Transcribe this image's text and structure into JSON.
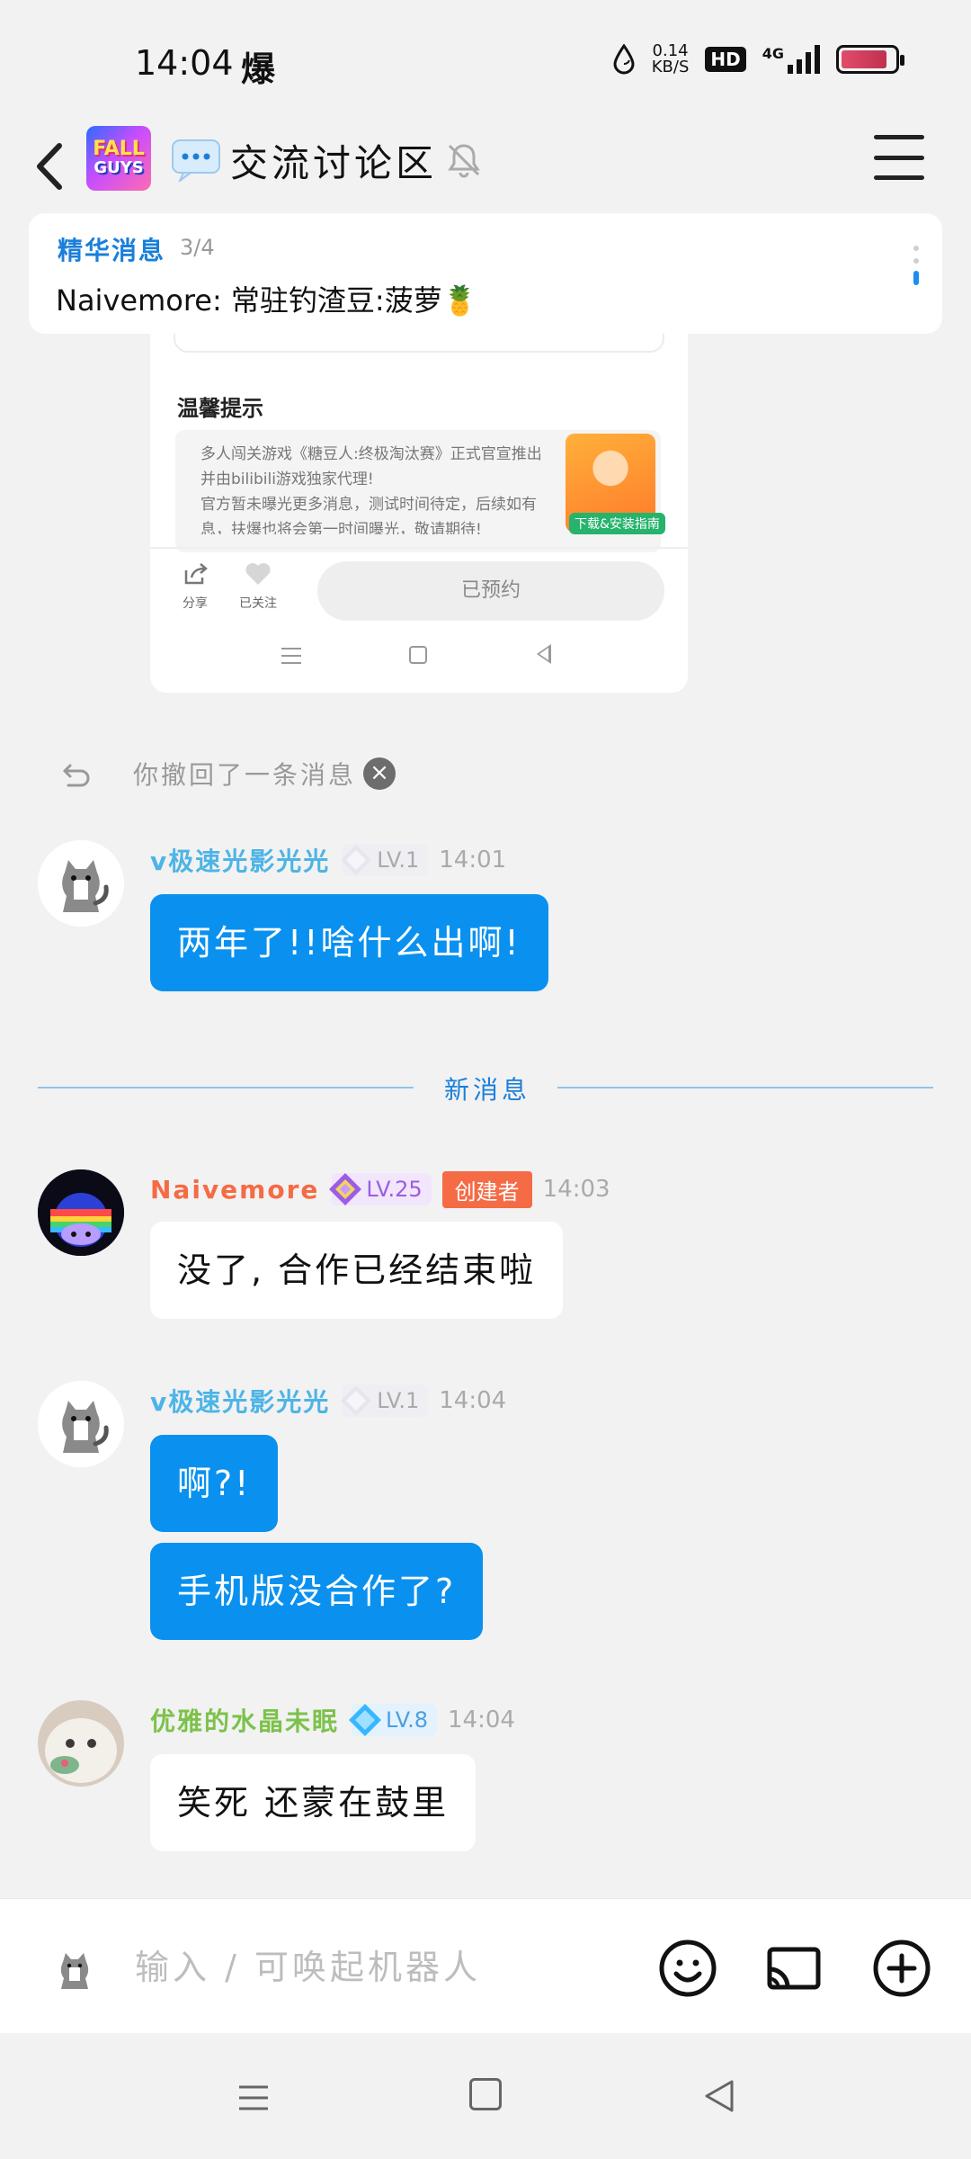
{
  "status_bar": {
    "time": "14:04",
    "notify_char": "爆",
    "net_speed_value": "0.14",
    "net_speed_unit": "KB/S",
    "hd": "HD",
    "network": "4G",
    "battery_level": 0.86
  },
  "header": {
    "group_avatar_line1": "FALL",
    "group_avatar_line2": "GUYS",
    "title": "交流讨论区"
  },
  "pinned": {
    "label": "精华消息",
    "count": "3/4",
    "text": "Naivemore: 常驻钓渣豆:菠萝🍍"
  },
  "screenshot": {
    "section_title": "温馨提示",
    "lines": [
      "多人闯关游戏《糖豆人:终极淘汰赛》正式官宣推出",
      "并由bilibili游戏独家代理!",
      "官方暂未曝光更多消息，测试时间待定，后续如有",
      "息，扶爆也将会第一时间曝光，敬请期待!"
    ],
    "guide_label": "下载&安装指南",
    "share_label": "分享",
    "follow_label": "已关注",
    "reserved_label": "已预约"
  },
  "recall": {
    "text": "你撤回了一条消息"
  },
  "divider": {
    "label": "新消息"
  },
  "messages": [
    {
      "name": "v极速光影光光",
      "level": "LV.1",
      "time": "14:01",
      "bubbles": [
        "两年了!!啥什么出啊!"
      ]
    },
    {
      "name": "Naivemore",
      "level": "LV.25",
      "badge": "创建者",
      "time": "14:03",
      "bubbles": [
        "没了, 合作已经结束啦"
      ]
    },
    {
      "name": "v极速光影光光",
      "level": "LV.1",
      "time": "14:04",
      "bubbles": [
        "啊?!",
        "手机版没合作了?"
      ]
    },
    {
      "name": "优雅的水晶未眠",
      "level": "LV.8",
      "time": "14:04",
      "bubbles": [
        "笑死 还蒙在鼓里"
      ]
    }
  ],
  "input": {
    "placeholder": "输入 / 可唤起机器人"
  },
  "colors": {
    "accent_blue": "#0a91f0",
    "link_blue": "#1a7fd9",
    "name_blue": "#4db4e6",
    "name_orange": "#f56b45",
    "name_green": "#7cc24a",
    "creator_badge": "#f56b45"
  },
  "icons": [
    "back-arrow-icon",
    "chat-bubble-icon",
    "mute-bell-icon",
    "hamburger-menu-icon",
    "recall-undo-icon",
    "close-circle-icon",
    "emoji-smile-icon",
    "screencast-icon",
    "plus-circle-icon"
  ]
}
